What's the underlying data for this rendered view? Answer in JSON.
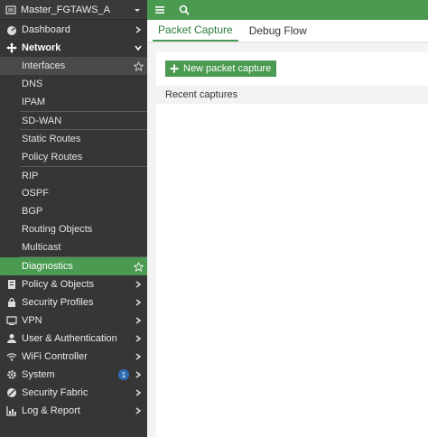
{
  "device": {
    "name": "Master_FGTAWS_A"
  },
  "sidebar": {
    "dashboard": "Dashboard",
    "network": "Network",
    "network_items": [
      "Interfaces",
      "DNS",
      "IPAM",
      "SD-WAN",
      "Static Routes",
      "Policy Routes",
      "RIP",
      "OSPF",
      "BGP",
      "Routing Objects",
      "Multicast"
    ],
    "diagnostics": "Diagnostics",
    "items": [
      {
        "label": "Policy & Objects",
        "icon": "policy-icon"
      },
      {
        "label": "Security Profiles",
        "icon": "lock-icon"
      },
      {
        "label": "VPN",
        "icon": "monitor-icon"
      },
      {
        "label": "User & Authentication",
        "icon": "user-icon"
      },
      {
        "label": "WiFi Controller",
        "icon": "wifi-icon"
      },
      {
        "label": "System",
        "icon": "gear-icon",
        "badge": "1"
      },
      {
        "label": "Security Fabric",
        "icon": "fabric-icon"
      },
      {
        "label": "Log & Report",
        "icon": "chart-icon"
      }
    ]
  },
  "tabs": {
    "packet_capture": "Packet Capture",
    "debug_flow": "Debug Flow"
  },
  "main": {
    "new_button": "New packet capture",
    "recent_header": "Recent captures"
  },
  "colors": {
    "accent": "#4b9a52",
    "sidebar_bg": "#363636",
    "badge": "#2f6eb5"
  }
}
